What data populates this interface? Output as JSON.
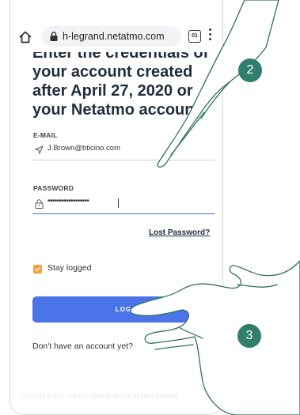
{
  "browser": {
    "url": "h-legrand.netatmo.com",
    "tab_count": "01"
  },
  "login": {
    "heading": "Enter the credentials of your account created after April 27, 2020 or your Netatmo account",
    "email_label": "E-MAIL",
    "email_value": "J.Brown@bticino.com",
    "password_label": "PASSWORD",
    "password_value": "••••••••••••••••••",
    "lost_password": "Lost Password?",
    "stay_logged": "Stay logged",
    "login_button": "LOG",
    "signup_prompt": "Don't have an account yet?",
    "copyright": "Copyright © 2020 Legrand, Netatmo, Bticino. All rights reserved"
  },
  "markers": {
    "step_2": "2",
    "step_3": "3"
  },
  "colors": {
    "accent_blue": "#4a74e8",
    "checkbox_orange": "#f2a23b",
    "marker_green": "#2f7f6c",
    "heading_navy": "#1f2d3d"
  }
}
